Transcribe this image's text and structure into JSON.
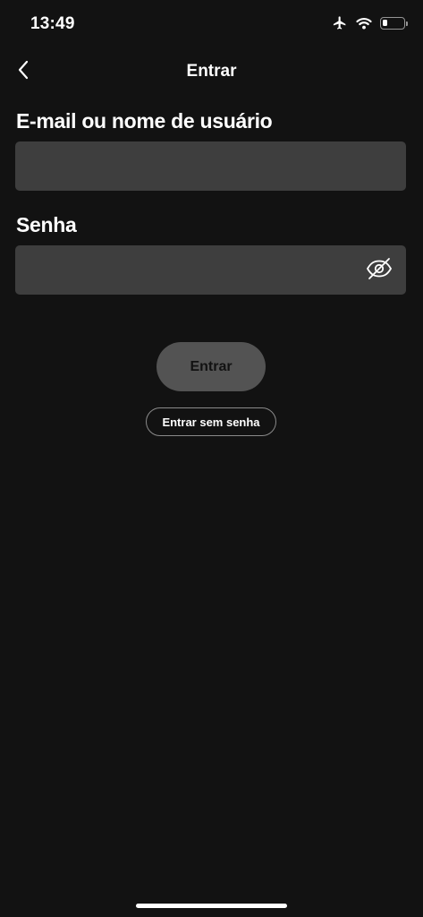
{
  "status_bar": {
    "time": "13:49",
    "icons": [
      "airplane-icon",
      "wifi-icon",
      "battery-icon"
    ],
    "battery_level": 0.25
  },
  "nav": {
    "back_icon": "chevron-left-icon",
    "title": "Entrar"
  },
  "form": {
    "email": {
      "label": "E-mail ou nome de usuário",
      "value": "",
      "placeholder": ""
    },
    "password": {
      "label": "Senha",
      "value": "",
      "placeholder": "",
      "toggle_icon": "eye-slash-icon"
    }
  },
  "actions": {
    "login_label": "Entrar",
    "passwordless_label": "Entrar sem senha"
  },
  "colors": {
    "background": "#121212",
    "field_background": "#3e3e3e",
    "disabled_button": "#535353",
    "text": "#ffffff"
  }
}
